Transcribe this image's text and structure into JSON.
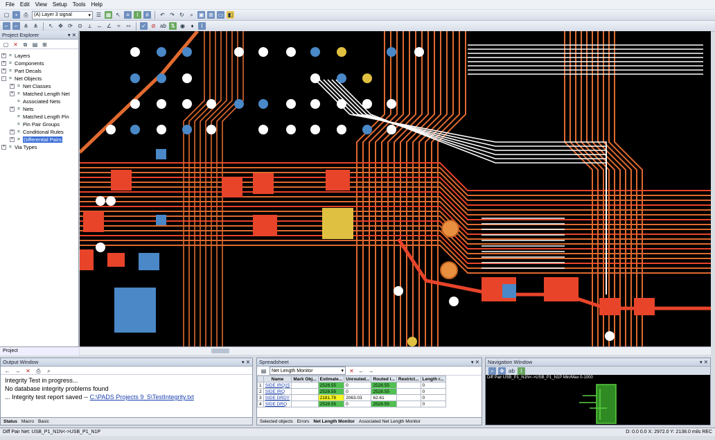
{
  "menu": [
    "File",
    "Edit",
    "View",
    "Setup",
    "Tools",
    "Help"
  ],
  "toolbar": {
    "layer_select": "(A) Layer 3 signal"
  },
  "explorer": {
    "title": "Project Explorer",
    "tab": "Project",
    "items": [
      {
        "label": "Layers",
        "level": 0,
        "expander": "+"
      },
      {
        "label": "Components",
        "level": 0,
        "expander": "+"
      },
      {
        "label": "Part Decals",
        "level": 0,
        "expander": "+"
      },
      {
        "label": "Net Objects",
        "level": 0,
        "expander": "-"
      },
      {
        "label": "Net Classes",
        "level": 1,
        "expander": "+"
      },
      {
        "label": "Matched Length Net",
        "level": 1,
        "expander": "+"
      },
      {
        "label": "Associated Nets",
        "level": 1,
        "expander": ""
      },
      {
        "label": "Nets",
        "level": 1,
        "expander": "+"
      },
      {
        "label": "Matched Length Pin",
        "level": 1,
        "expander": ""
      },
      {
        "label": "Pin Pair Groups",
        "level": 1,
        "expander": ""
      },
      {
        "label": "Conditional Rules",
        "level": 1,
        "expander": "+"
      },
      {
        "label": "Differential Pairs",
        "level": 1,
        "expander": "+",
        "selected": true
      },
      {
        "label": "Via Types",
        "level": 0,
        "expander": "+"
      }
    ]
  },
  "output": {
    "title": "Output Window",
    "lines": [
      "Integrity Test in progress...",
      "No database integrity problems found",
      "... Integrity test report saved -- "
    ],
    "link": "C:\\PADS Projects 9_5\\TestIntegrity.txt",
    "tabs": [
      "Status",
      "Macro",
      "Basic"
    ]
  },
  "spreadsheet": {
    "title": "Spreadsheet",
    "monitor": "Net Length Monitor",
    "columns": [
      "",
      "Name",
      "Mark Obj...",
      "Estimate...",
      "Unrouted...",
      "Routed l...",
      "Restrict...",
      "Length r..."
    ],
    "rows": [
      [
        "1",
        "SIDE IRQ15",
        "",
        "2528.55",
        "0",
        "2528.55",
        "",
        "0"
      ],
      [
        "2",
        "SIDE IRQ",
        "",
        "2528.55",
        "0",
        "2528.55",
        "",
        "0"
      ],
      [
        "3",
        "SIDE DRDY",
        "",
        "2181.78",
        "2063.03",
        "62.61",
        "",
        "0"
      ],
      [
        "4",
        "SIDE DRQ",
        "",
        "2528.55",
        "0",
        "2528.55",
        "",
        "0"
      ]
    ],
    "tabs": [
      "Selected objects",
      "Errors",
      "Net Length Monitor",
      "Associated Net Length Monitor"
    ]
  },
  "navigation": {
    "title": "Navigation Window",
    "caption": "Diff Pair USB_P1_N1N<->USB_P1_N1P Min/Max 0-1000"
  },
  "status": {
    "left": "Diff Pair Net: USB_P1_N1N<->USB_P1_N1P",
    "right": "D: 0.0 0.0  X: 2972.0  Y: 2138.0  mils    REC"
  }
}
